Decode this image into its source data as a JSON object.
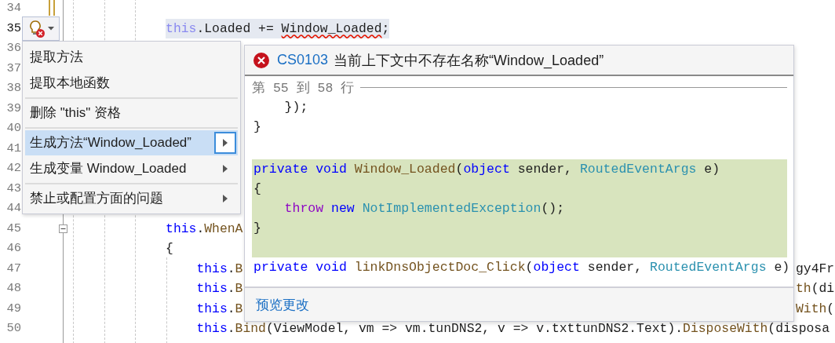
{
  "editor": {
    "lines": [
      {
        "number": "34",
        "current": false
      },
      {
        "number": "35",
        "current": true,
        "highlighted": true,
        "tokens": [
          {
            "text": "            this",
            "kind": "faded_keyword"
          },
          {
            "text": ".Loaded += ",
            "kind": "plain"
          },
          {
            "text": "Window_Loaded",
            "kind": "plain",
            "error": true
          },
          {
            "text": ";",
            "kind": "plain"
          }
        ]
      },
      {
        "number": "36",
        "current": false
      },
      {
        "number": "37",
        "current": false
      },
      {
        "number": "38",
        "current": false
      },
      {
        "number": "39",
        "current": false
      },
      {
        "number": "40",
        "current": false
      },
      {
        "number": "41",
        "current": false
      },
      {
        "number": "42",
        "current": false
      },
      {
        "number": "43",
        "current": false
      },
      {
        "number": "44",
        "current": false
      },
      {
        "number": "45",
        "current": false,
        "collapsible": true,
        "tokens": [
          {
            "text": "            this",
            "kind": "keyword"
          },
          {
            "text": ".",
            "kind": "plain"
          },
          {
            "text": "WhenA",
            "kind": "method"
          }
        ]
      },
      {
        "number": "46",
        "current": false,
        "tokens": [
          {
            "text": "            {",
            "kind": "plain"
          }
        ]
      },
      {
        "number": "47",
        "current": false,
        "tokens": [
          {
            "text": "                this",
            "kind": "keyword"
          },
          {
            "text": ".",
            "kind": "plain"
          },
          {
            "text": "B",
            "kind": "method"
          }
        ],
        "right": [
          {
            "text": "gy4Fr",
            "kind": "plain"
          }
        ]
      },
      {
        "number": "48",
        "current": false,
        "tokens": [
          {
            "text": "                this",
            "kind": "keyword"
          },
          {
            "text": ".",
            "kind": "plain"
          },
          {
            "text": "B",
            "kind": "method"
          }
        ],
        "right": [
          {
            "text": "th",
            "kind": "method"
          },
          {
            "text": "(di",
            "kind": "plain"
          }
        ]
      },
      {
        "number": "49",
        "current": false,
        "tokens": [
          {
            "text": "                this",
            "kind": "keyword"
          },
          {
            "text": ".",
            "kind": "plain"
          },
          {
            "text": "B",
            "kind": "method"
          }
        ],
        "right": [
          {
            "text": "With",
            "kind": "method"
          },
          {
            "text": "(",
            "kind": "plain"
          }
        ]
      },
      {
        "number": "50",
        "current": false,
        "tokens": [
          {
            "text": "                this",
            "kind": "keyword"
          },
          {
            "text": ".",
            "kind": "plain"
          },
          {
            "text": "Bind",
            "kind": "method"
          },
          {
            "text": "(ViewModel, vm => vm.tunDNS2, v => v.txttunDNS2.Text).",
            "kind": "plain"
          },
          {
            "text": "DisposeWith",
            "kind": "method"
          },
          {
            "text": "(disposa",
            "kind": "plain"
          }
        ]
      }
    ]
  },
  "quick_actions_menu": {
    "items": [
      {
        "label": "提取方法",
        "selected": false,
        "submenu": false,
        "separator_before": false
      },
      {
        "label": "提取本地函数",
        "selected": false,
        "submenu": false,
        "separator_before": false
      },
      {
        "label": "删除 \"this\" 资格",
        "selected": false,
        "submenu": false,
        "separator_before": true
      },
      {
        "label": "生成方法“Window_Loaded”",
        "selected": true,
        "submenu": true,
        "separator_before": true
      },
      {
        "label": "生成变量 Window_Loaded",
        "selected": false,
        "submenu": true,
        "separator_before": false
      },
      {
        "label": "禁止或配置方面的问题",
        "selected": false,
        "submenu": true,
        "separator_before": true
      }
    ]
  },
  "preview": {
    "error_code": "CS0103",
    "message": "当前上下文中不存在名称“Window_Loaded”",
    "range": "第 55 到 58 行",
    "lines": [
      {
        "added": false,
        "tokens": [
          {
            "text": "    });",
            "kind": "plain"
          }
        ]
      },
      {
        "added": false,
        "tokens": [
          {
            "text": "}",
            "kind": "plain"
          }
        ]
      },
      {
        "added": false
      },
      {
        "added": true,
        "tokens": [
          {
            "text": "private void ",
            "kind": "keyword"
          },
          {
            "text": "Window_Loaded",
            "kind": "method"
          },
          {
            "text": "(",
            "kind": "plain"
          },
          {
            "text": "object ",
            "kind": "keyword"
          },
          {
            "text": "sender, ",
            "kind": "plain"
          },
          {
            "text": "RoutedEventArgs ",
            "kind": "type"
          },
          {
            "text": "e)",
            "kind": "plain"
          }
        ]
      },
      {
        "added": true,
        "tokens": [
          {
            "text": "{",
            "kind": "plain"
          }
        ]
      },
      {
        "added": true,
        "tokens": [
          {
            "text": "    throw ",
            "kind": "control"
          },
          {
            "text": "new ",
            "kind": "keyword"
          },
          {
            "text": "NotImplementedException",
            "kind": "type"
          },
          {
            "text": "();",
            "kind": "plain"
          }
        ]
      },
      {
        "added": true,
        "tokens": [
          {
            "text": "}",
            "kind": "plain"
          }
        ]
      },
      {
        "added": true
      },
      {
        "added": false,
        "tokens": [
          {
            "text": "private void ",
            "kind": "keyword"
          },
          {
            "text": "linkDnsObjectDoc_Click",
            "kind": "method"
          },
          {
            "text": "(",
            "kind": "plain"
          },
          {
            "text": "object ",
            "kind": "keyword"
          },
          {
            "text": "sender, ",
            "kind": "plain"
          },
          {
            "text": "RoutedEventArgs ",
            "kind": "type"
          },
          {
            "text": "e)",
            "kind": "plain"
          }
        ]
      }
    ],
    "footer_link": "预览更改"
  }
}
